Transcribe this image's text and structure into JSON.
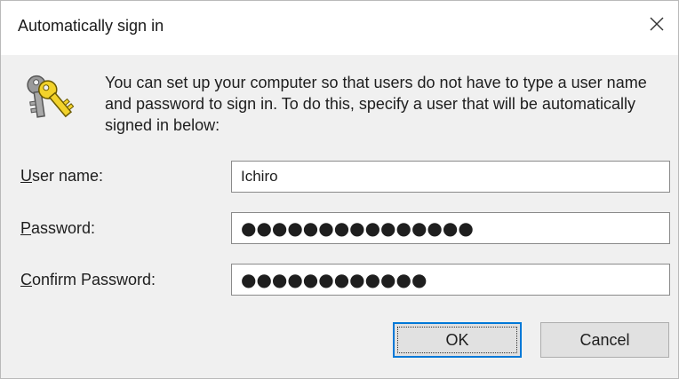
{
  "window": {
    "title": "Automatically sign in",
    "close_icon": "close-icon"
  },
  "intro": {
    "icon": "keys-icon",
    "text": "You can set up your computer so that users do not have to type a user name and password to sign in. To do this, specify a user that will be automatically signed in below:"
  },
  "fields": {
    "username": {
      "label": "User name:",
      "value": "Ichiro"
    },
    "password": {
      "label": "Password:",
      "value": "●●●●●●●●●●●●●●●"
    },
    "confirm_password": {
      "label": "Confirm Password:",
      "value": "●●●●●●●●●●●●"
    }
  },
  "buttons": {
    "ok": "OK",
    "cancel": "Cancel"
  },
  "colors": {
    "title_bar": "#ffffff",
    "dialog_body": "#f0f0f0",
    "focus_accent": "#0078d7"
  }
}
